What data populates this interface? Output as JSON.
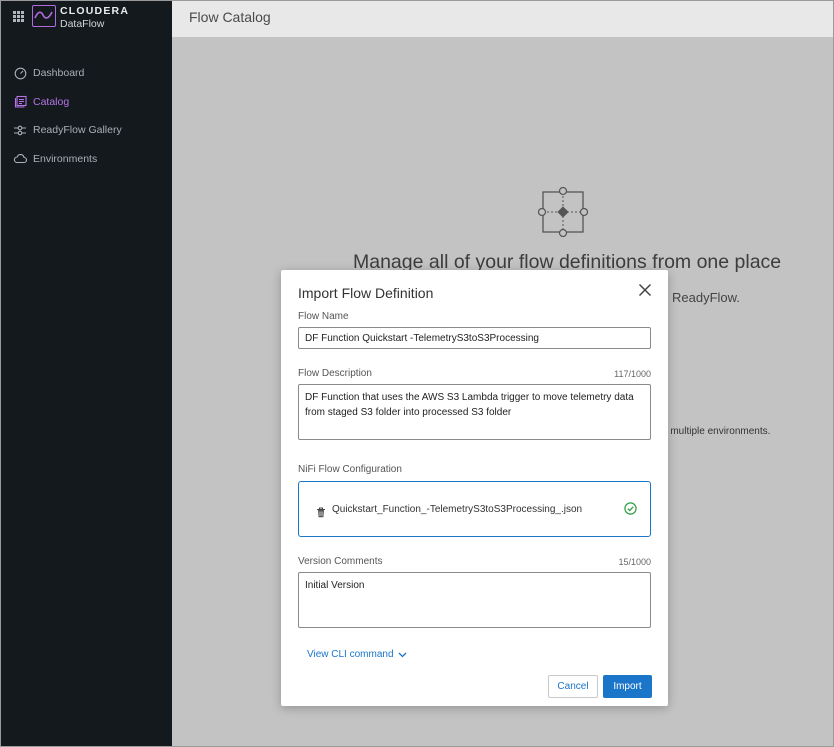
{
  "brand": {
    "name": "CLOUDERA",
    "product": "DataFlow"
  },
  "sidebar": {
    "items": [
      {
        "label": "Dashboard",
        "icon": "dashboard-icon",
        "active": false
      },
      {
        "label": "Catalog",
        "icon": "catalog-icon",
        "active": true
      },
      {
        "label": "ReadyFlow Gallery",
        "icon": "readyflow-gallery-icon",
        "active": false
      },
      {
        "label": "Environments",
        "icon": "cloud-icon",
        "active": false
      }
    ]
  },
  "page": {
    "title": "Flow Catalog",
    "background_heading": "Manage all of your flow definitions from one place",
    "background_subtext": "ReadyFlow.",
    "background_note": "o multiple environments."
  },
  "modal": {
    "title": "Import Flow Definition",
    "flow_name": {
      "label": "Flow Name",
      "value": "DF Function Quickstart -TelemetryS3toS3Processing"
    },
    "flow_description": {
      "label": "Flow Description",
      "counter": "117/1000",
      "value": "DF Function that uses the AWS S3 Lambda trigger to move telemetry data from staged S3 folder into processed S3 folder"
    },
    "nifi_config": {
      "label": "NiFi Flow Configuration",
      "file_name": "Quickstart_Function_-TelemetryS3toS3Processing_.json"
    },
    "version_comments": {
      "label": "Version Comments",
      "counter": "15/1000",
      "value": "Initial Version"
    },
    "cli_link": "View CLI command",
    "cancel_label": "Cancel",
    "import_label": "Import"
  },
  "colors": {
    "sidebar_bg": "#13191d",
    "accent_purple": "#b575e6",
    "primary_blue": "#1b75c9",
    "success_green": "#2e9e44"
  }
}
